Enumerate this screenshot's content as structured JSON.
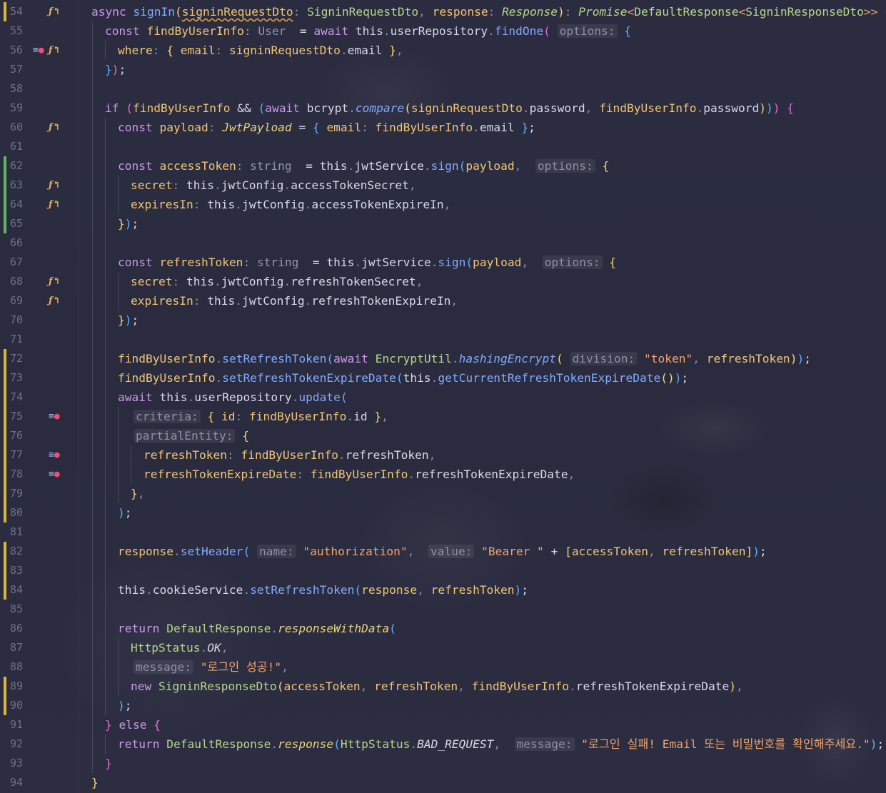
{
  "editor": {
    "lines": [
      {
        "n": "54",
        "git": "modified",
        "icon": "fx"
      },
      {
        "n": "55",
        "git": "",
        "icon": ""
      },
      {
        "n": "56",
        "git": "",
        "icon": "ref-fx"
      },
      {
        "n": "57",
        "git": "",
        "icon": ""
      },
      {
        "n": "58",
        "git": "",
        "icon": ""
      },
      {
        "n": "59",
        "git": "",
        "icon": ""
      },
      {
        "n": "60",
        "git": "",
        "icon": "fx"
      },
      {
        "n": "61",
        "git": "",
        "icon": ""
      },
      {
        "n": "62",
        "git": "added",
        "icon": ""
      },
      {
        "n": "63",
        "git": "added",
        "icon": "fx"
      },
      {
        "n": "64",
        "git": "added",
        "icon": "fx"
      },
      {
        "n": "65",
        "git": "added",
        "icon": ""
      },
      {
        "n": "66",
        "git": "",
        "icon": ""
      },
      {
        "n": "67",
        "git": "",
        "icon": ""
      },
      {
        "n": "68",
        "git": "",
        "icon": "fx"
      },
      {
        "n": "69",
        "git": "",
        "icon": "fx"
      },
      {
        "n": "70",
        "git": "",
        "icon": ""
      },
      {
        "n": "71",
        "git": "",
        "icon": ""
      },
      {
        "n": "72",
        "git": "modified",
        "icon": ""
      },
      {
        "n": "73",
        "git": "modified",
        "icon": ""
      },
      {
        "n": "74",
        "git": "modified",
        "icon": ""
      },
      {
        "n": "75",
        "git": "modified",
        "icon": "ref"
      },
      {
        "n": "76",
        "git": "modified",
        "icon": ""
      },
      {
        "n": "77",
        "git": "modified",
        "icon": "ref"
      },
      {
        "n": "78",
        "git": "modified",
        "icon": "ref"
      },
      {
        "n": "79",
        "git": "modified",
        "icon": ""
      },
      {
        "n": "80",
        "git": "modified",
        "icon": ""
      },
      {
        "n": "81",
        "git": "",
        "icon": ""
      },
      {
        "n": "82",
        "git": "modified",
        "icon": ""
      },
      {
        "n": "83",
        "git": "modified",
        "icon": ""
      },
      {
        "n": "84",
        "git": "modified",
        "icon": ""
      },
      {
        "n": "85",
        "git": "",
        "icon": ""
      },
      {
        "n": "86",
        "git": "",
        "icon": ""
      },
      {
        "n": "87",
        "git": "",
        "icon": ""
      },
      {
        "n": "88",
        "git": "",
        "icon": ""
      },
      {
        "n": "89",
        "git": "modified",
        "icon": ""
      },
      {
        "n": "90",
        "git": "modified",
        "icon": ""
      },
      {
        "n": "91",
        "git": "",
        "icon": ""
      },
      {
        "n": "92",
        "git": "",
        "icon": ""
      },
      {
        "n": "93",
        "git": "",
        "icon": ""
      },
      {
        "n": "94",
        "git": "",
        "icon": ""
      }
    ],
    "colors": {
      "git_modified": "#d9b53a",
      "git_added": "#5fb760",
      "background": "#2a2b3d"
    }
  },
  "code": {
    "l54": {
      "async": "async",
      "signIn": "signIn",
      "param1": "signinRequestDto",
      "type1": "SigninRequestDto",
      "param2": "response",
      "type2": "Response",
      "ret": "Promise",
      "ret_inner": "DefaultResponse",
      "ret_inner2": "SigninResponseDto"
    },
    "l55": {
      "const": "const",
      "var": "findByUserInfo",
      "inlay": ": User",
      "await": "await",
      "this": "this",
      "prop": "userRepository",
      "fn": "findOne",
      "hint": "options:"
    },
    "l56": {
      "key": "where",
      "prop": "email",
      "obj": "signinRequestDto",
      "field": "email"
    },
    "l59": {
      "if": "if",
      "a": "findByUserInfo",
      "await": "await",
      "obj": "bcrypt",
      "fn": "compare",
      "arg1": "signinRequestDto",
      "arg1f": "password",
      "arg2": "findByUserInfo",
      "arg2f": "password"
    },
    "l60": {
      "const": "const",
      "var": "payload",
      "type": "JwtPayload",
      "key": "email",
      "obj": "findByUserInfo",
      "field": "email"
    },
    "l62": {
      "const": "const",
      "var": "accessToken",
      "inlay": ": string",
      "this": "this",
      "prop": "jwtService",
      "fn": "sign",
      "arg": "payload",
      "hint": "options:"
    },
    "l63": {
      "key": "secret",
      "this": "this",
      "prop": "jwtConfig",
      "field": "accessTokenSecret"
    },
    "l64": {
      "key": "expiresIn",
      "this": "this",
      "prop": "jwtConfig",
      "field": "accessTokenExpireIn"
    },
    "l67": {
      "const": "const",
      "var": "refreshToken",
      "inlay": ": string",
      "this": "this",
      "prop": "jwtService",
      "fn": "sign",
      "arg": "payload",
      "hint": "options:"
    },
    "l68": {
      "key": "secret",
      "this": "this",
      "prop": "jwtConfig",
      "field": "refreshTokenSecret"
    },
    "l69": {
      "key": "expiresIn",
      "this": "this",
      "prop": "jwtConfig",
      "field": "refreshTokenExpireIn"
    },
    "l72": {
      "obj": "findByUserInfo",
      "fn": "setRefreshToken",
      "await": "await",
      "cls": "EncryptUtil",
      "fn2": "hashingEncrypt",
      "hint": "division:",
      "str": "\"token\"",
      "arg": "refreshToken"
    },
    "l73": {
      "obj": "findByUserInfo",
      "fn": "setRefreshTokenExpireDate",
      "this": "this",
      "fn2": "getCurrentRefreshTokenExpireDate"
    },
    "l74": {
      "await": "await",
      "this": "this",
      "prop": "userRepository",
      "fn": "update"
    },
    "l75": {
      "hint": "criteria:",
      "key": "id",
      "obj": "findByUserInfo",
      "field": "id"
    },
    "l76": {
      "hint": "partialEntity:"
    },
    "l77": {
      "key": "refreshToken",
      "obj": "findByUserInfo",
      "field": "refreshToken"
    },
    "l78": {
      "key": "refreshTokenExpireDate",
      "obj": "findByUserInfo",
      "field": "refreshTokenExpireDate"
    },
    "l82": {
      "obj": "response",
      "fn": "setHeader",
      "hint1": "name:",
      "str1": "\"authorization\"",
      "hint2": "value:",
      "str2": "\"Bearer \"",
      "a": "accessToken",
      "b": "refreshToken"
    },
    "l84": {
      "this": "this",
      "prop": "cookieService",
      "fn": "setRefreshToken",
      "a": "response",
      "b": "refreshToken"
    },
    "l86": {
      "return": "return",
      "cls": "DefaultResponse",
      "fn": "responseWithData"
    },
    "l87": {
      "cls": "HttpStatus",
      "field": "OK"
    },
    "l88": {
      "hint": "message:",
      "str": "\"로그인 성공!\""
    },
    "l89": {
      "new": "new",
      "cls": "SigninResponseDto",
      "a": "accessToken",
      "b": "refreshToken",
      "c": "findByUserInfo",
      "cf": "refreshTokenExpireDate"
    },
    "l91": {
      "else": "else"
    },
    "l92": {
      "return": "return",
      "cls": "DefaultResponse",
      "fn": "response",
      "cls2": "HttpStatus",
      "field": "BAD_REQUEST",
      "hint": "message:",
      "str": "\"로그인 실패! Email 또는 비밀번호를 확인해주세요.\""
    }
  }
}
